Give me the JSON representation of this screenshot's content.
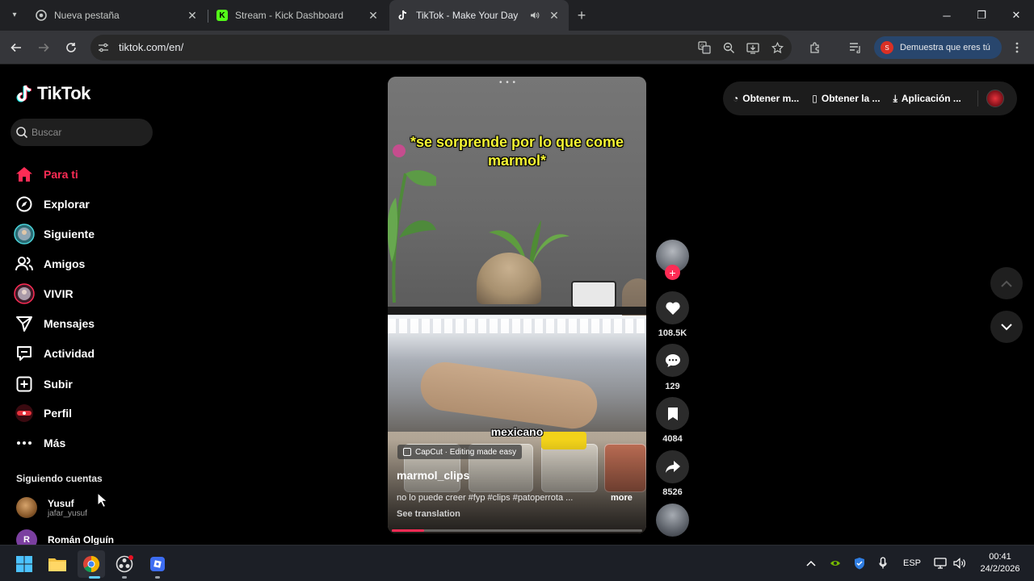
{
  "browser": {
    "tabs": [
      {
        "title": "Nueva pestaña",
        "favicon": "chrome-icon",
        "active": false
      },
      {
        "title": "Stream - Kick Dashboard",
        "favicon": "kick-icon",
        "active": false
      },
      {
        "title": "TikTok - Make Your Day",
        "favicon": "tiktok-icon",
        "active": true
      }
    ],
    "url": "tiktok.com/en/",
    "profile_label": "Demuestra que eres tú",
    "profile_initial": "S"
  },
  "tiktok": {
    "logo_text": "TikTok",
    "search_placeholder": "Buscar",
    "nav": [
      {
        "label": "Para ti",
        "icon": "home-icon",
        "active": true
      },
      {
        "label": "Explorar",
        "icon": "compass-icon",
        "active": false
      },
      {
        "label": "Siguiente",
        "icon": "following-avatar-icon",
        "active": false
      },
      {
        "label": "Amigos",
        "icon": "friends-icon",
        "active": false
      },
      {
        "label": "VIVIR",
        "icon": "live-avatar-icon",
        "active": false
      },
      {
        "label": "Mensajes",
        "icon": "send-icon",
        "active": false
      },
      {
        "label": "Actividad",
        "icon": "activity-icon",
        "active": false
      },
      {
        "label": "Subir",
        "icon": "upload-icon",
        "active": false
      },
      {
        "label": "Perfil",
        "icon": "profile-avatar-icon",
        "active": false
      },
      {
        "label": "Más",
        "icon": "more-icon",
        "active": false
      }
    ],
    "following_header": "Siguiendo cuentas",
    "following": [
      {
        "name": "Yusuf",
        "handle": "jafar_yusuf",
        "initial": "",
        "color": "#8a5a2b"
      },
      {
        "name": "Román Olguín",
        "handle": "",
        "initial": "R",
        "color": "#7b3fa0"
      }
    ],
    "topbar": {
      "item1": "Obtener m...",
      "item2": "Obtener la ...",
      "item3": "Aplicación ..."
    },
    "video": {
      "caption": "*se sorprende por lo que come marmol*",
      "subtitle": "mexicano",
      "capcut": "CapCut · Editing made easy",
      "author": "marmol_clips",
      "description": "no lo puede creer #fyp #clips #patoperrota ...",
      "more": "more",
      "translation": "See translation",
      "progress": 0.13
    },
    "actions": {
      "likes": "108.5K",
      "comments": "129",
      "saves": "4084",
      "shares": "8526"
    }
  },
  "taskbar": {
    "lang": "ESP",
    "time": "00:41",
    "date": "24/2/2026"
  },
  "colors": {
    "accent": "#fe2c55",
    "caption": "#f5f534",
    "profile_pill": "#28466d"
  }
}
